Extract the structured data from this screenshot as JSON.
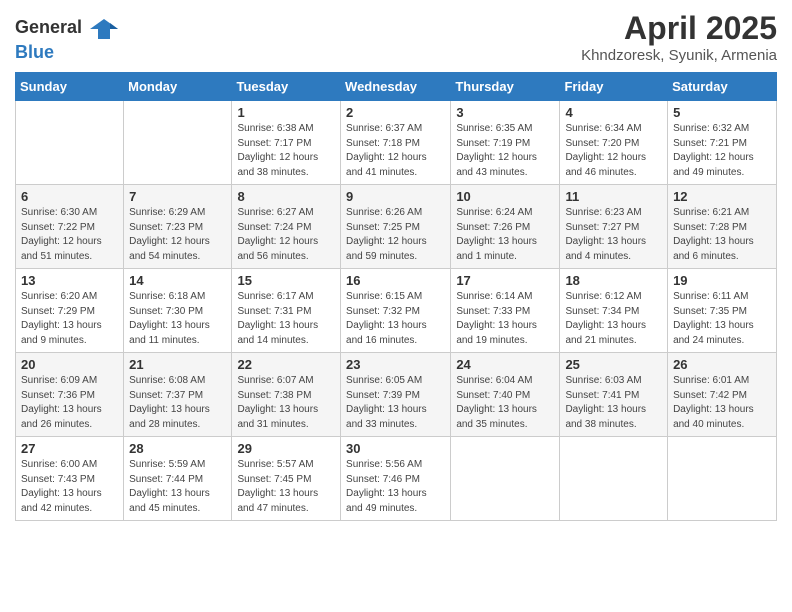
{
  "logo": {
    "general": "General",
    "blue": "Blue"
  },
  "title": "April 2025",
  "subtitle": "Khndzoresk, Syunik, Armenia",
  "weekdays": [
    "Sunday",
    "Monday",
    "Tuesday",
    "Wednesday",
    "Thursday",
    "Friday",
    "Saturday"
  ],
  "weeks": [
    [
      {
        "day": "",
        "info": ""
      },
      {
        "day": "",
        "info": ""
      },
      {
        "day": "1",
        "info": "Sunrise: 6:38 AM\nSunset: 7:17 PM\nDaylight: 12 hours and 38 minutes."
      },
      {
        "day": "2",
        "info": "Sunrise: 6:37 AM\nSunset: 7:18 PM\nDaylight: 12 hours and 41 minutes."
      },
      {
        "day": "3",
        "info": "Sunrise: 6:35 AM\nSunset: 7:19 PM\nDaylight: 12 hours and 43 minutes."
      },
      {
        "day": "4",
        "info": "Sunrise: 6:34 AM\nSunset: 7:20 PM\nDaylight: 12 hours and 46 minutes."
      },
      {
        "day": "5",
        "info": "Sunrise: 6:32 AM\nSunset: 7:21 PM\nDaylight: 12 hours and 49 minutes."
      }
    ],
    [
      {
        "day": "6",
        "info": "Sunrise: 6:30 AM\nSunset: 7:22 PM\nDaylight: 12 hours and 51 minutes."
      },
      {
        "day": "7",
        "info": "Sunrise: 6:29 AM\nSunset: 7:23 PM\nDaylight: 12 hours and 54 minutes."
      },
      {
        "day": "8",
        "info": "Sunrise: 6:27 AM\nSunset: 7:24 PM\nDaylight: 12 hours and 56 minutes."
      },
      {
        "day": "9",
        "info": "Sunrise: 6:26 AM\nSunset: 7:25 PM\nDaylight: 12 hours and 59 minutes."
      },
      {
        "day": "10",
        "info": "Sunrise: 6:24 AM\nSunset: 7:26 PM\nDaylight: 13 hours and 1 minute."
      },
      {
        "day": "11",
        "info": "Sunrise: 6:23 AM\nSunset: 7:27 PM\nDaylight: 13 hours and 4 minutes."
      },
      {
        "day": "12",
        "info": "Sunrise: 6:21 AM\nSunset: 7:28 PM\nDaylight: 13 hours and 6 minutes."
      }
    ],
    [
      {
        "day": "13",
        "info": "Sunrise: 6:20 AM\nSunset: 7:29 PM\nDaylight: 13 hours and 9 minutes."
      },
      {
        "day": "14",
        "info": "Sunrise: 6:18 AM\nSunset: 7:30 PM\nDaylight: 13 hours and 11 minutes."
      },
      {
        "day": "15",
        "info": "Sunrise: 6:17 AM\nSunset: 7:31 PM\nDaylight: 13 hours and 14 minutes."
      },
      {
        "day": "16",
        "info": "Sunrise: 6:15 AM\nSunset: 7:32 PM\nDaylight: 13 hours and 16 minutes."
      },
      {
        "day": "17",
        "info": "Sunrise: 6:14 AM\nSunset: 7:33 PM\nDaylight: 13 hours and 19 minutes."
      },
      {
        "day": "18",
        "info": "Sunrise: 6:12 AM\nSunset: 7:34 PM\nDaylight: 13 hours and 21 minutes."
      },
      {
        "day": "19",
        "info": "Sunrise: 6:11 AM\nSunset: 7:35 PM\nDaylight: 13 hours and 24 minutes."
      }
    ],
    [
      {
        "day": "20",
        "info": "Sunrise: 6:09 AM\nSunset: 7:36 PM\nDaylight: 13 hours and 26 minutes."
      },
      {
        "day": "21",
        "info": "Sunrise: 6:08 AM\nSunset: 7:37 PM\nDaylight: 13 hours and 28 minutes."
      },
      {
        "day": "22",
        "info": "Sunrise: 6:07 AM\nSunset: 7:38 PM\nDaylight: 13 hours and 31 minutes."
      },
      {
        "day": "23",
        "info": "Sunrise: 6:05 AM\nSunset: 7:39 PM\nDaylight: 13 hours and 33 minutes."
      },
      {
        "day": "24",
        "info": "Sunrise: 6:04 AM\nSunset: 7:40 PM\nDaylight: 13 hours and 35 minutes."
      },
      {
        "day": "25",
        "info": "Sunrise: 6:03 AM\nSunset: 7:41 PM\nDaylight: 13 hours and 38 minutes."
      },
      {
        "day": "26",
        "info": "Sunrise: 6:01 AM\nSunset: 7:42 PM\nDaylight: 13 hours and 40 minutes."
      }
    ],
    [
      {
        "day": "27",
        "info": "Sunrise: 6:00 AM\nSunset: 7:43 PM\nDaylight: 13 hours and 42 minutes."
      },
      {
        "day": "28",
        "info": "Sunrise: 5:59 AM\nSunset: 7:44 PM\nDaylight: 13 hours and 45 minutes."
      },
      {
        "day": "29",
        "info": "Sunrise: 5:57 AM\nSunset: 7:45 PM\nDaylight: 13 hours and 47 minutes."
      },
      {
        "day": "30",
        "info": "Sunrise: 5:56 AM\nSunset: 7:46 PM\nDaylight: 13 hours and 49 minutes."
      },
      {
        "day": "",
        "info": ""
      },
      {
        "day": "",
        "info": ""
      },
      {
        "day": "",
        "info": ""
      }
    ]
  ]
}
